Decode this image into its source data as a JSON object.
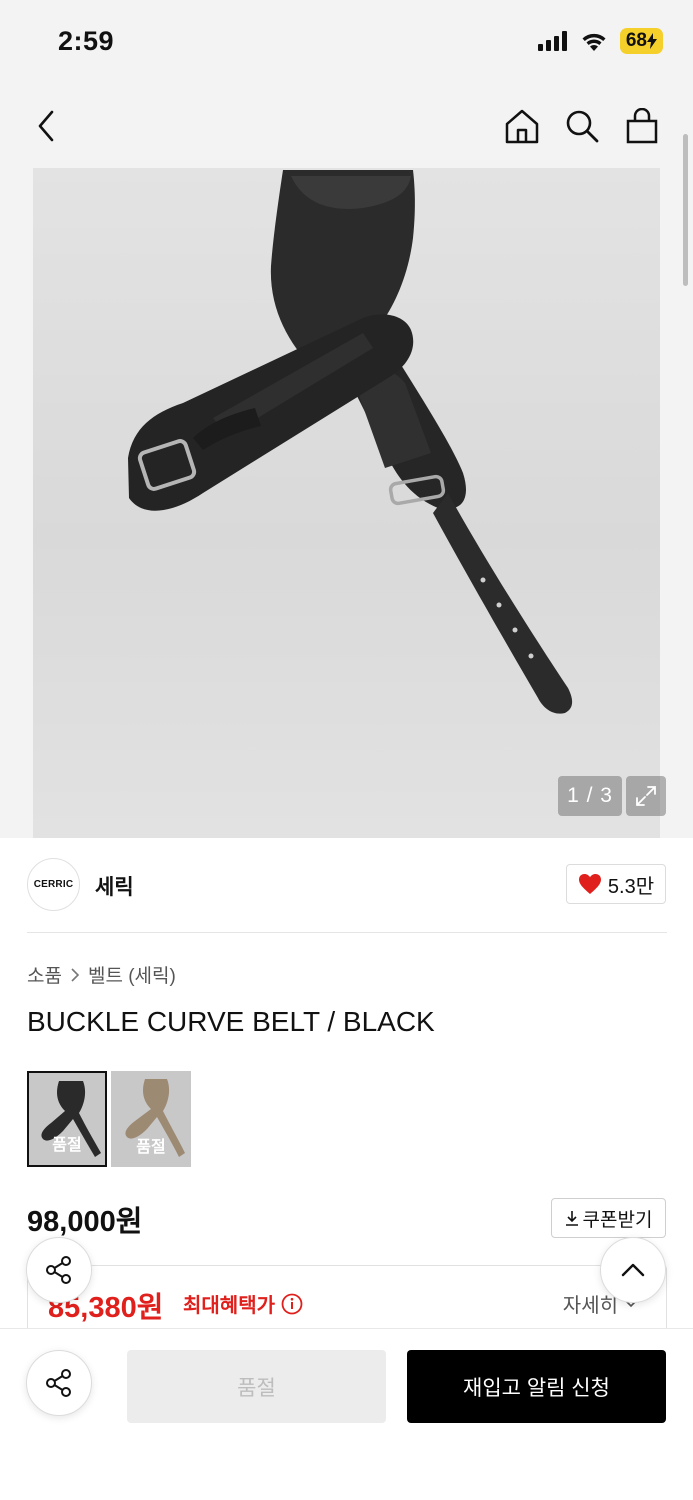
{
  "status_bar": {
    "time": "2:59",
    "battery": "68"
  },
  "header": {
    "back_icon": "chevron-left-icon",
    "home_icon": "home-icon",
    "search_icon": "search-icon",
    "cart_icon": "shopping-bag-icon"
  },
  "gallery": {
    "counter": "1 / 3",
    "current": 1,
    "total": 3
  },
  "brand": {
    "logo_text": "CERRIC",
    "name": "세릭",
    "likes": "5.3만"
  },
  "breadcrumb": {
    "level1": "소품",
    "level2": "벨트 (세릭)"
  },
  "product": {
    "title": "BUCKLE CURVE BELT / BLACK",
    "price": "98,000원",
    "coupon_label": "쿠폰받기",
    "benefit_price": "85,380원",
    "benefit_label": "최대혜택가",
    "detail_label": "자세히"
  },
  "swatches": [
    {
      "color": "black",
      "badge": "품절",
      "selected": true
    },
    {
      "color": "taupe",
      "badge": "품절",
      "selected": false
    }
  ],
  "bottom_bar": {
    "soldout_label": "품절",
    "restock_label": "재입고 알림 신청"
  },
  "colors": {
    "accent_red": "#e0201c",
    "primary_black": "#000000",
    "disabled_bg": "#ececec",
    "battery_yellow": "#f5cf2a"
  }
}
